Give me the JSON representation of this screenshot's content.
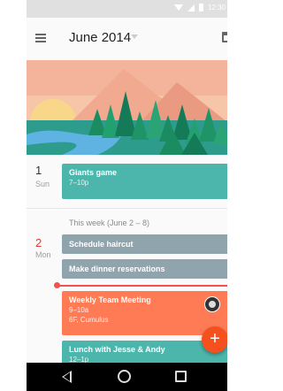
{
  "status_bar": {
    "time": "12:30",
    "icons": [
      "download-icon",
      "signal-icon",
      "battery-icon"
    ]
  },
  "app_bar": {
    "month_title": "June 2014",
    "icons": [
      "menu-icon",
      "dropdown-caret-icon",
      "calendar-icon"
    ]
  },
  "schedule": {
    "days": [
      {
        "number": "1",
        "weekday": "Sun",
        "events": [
          {
            "title": "Giants game",
            "time": "7–10p",
            "color": "#4db6ac"
          }
        ]
      },
      {
        "number": "2",
        "weekday": "Mon",
        "week_label": "This week (June 2 – 8)",
        "events": [
          {
            "title": "Schedule haircut",
            "color": "#90a4ae"
          },
          {
            "title": "Make dinner reservations",
            "color": "#90a4ae"
          },
          {
            "title": "Weekly Team Meeting",
            "time": "9–10a",
            "location": "6F, Cumulus",
            "color": "#ff7b56"
          },
          {
            "title": "Lunch with Jesse & Andy",
            "time": "12–1p",
            "color": "#4db6ac"
          }
        ]
      }
    ]
  },
  "fab": {
    "label": "+",
    "color": "#f4511e"
  },
  "colors": {
    "now_indicator": "#ef5350",
    "today": "#e53935"
  },
  "nav_bar": {
    "icons": [
      "back-icon",
      "home-icon",
      "recents-icon"
    ]
  }
}
